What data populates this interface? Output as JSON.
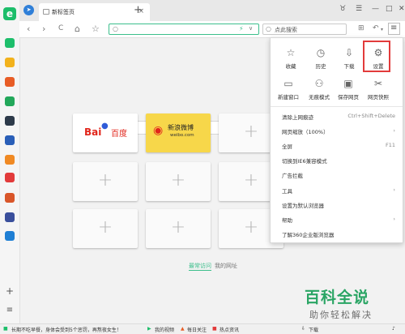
{
  "browser": {
    "tab_title": "新标签页",
    "tab_close": "×",
    "new_tab": "+"
  },
  "toolbar": {
    "back": "‹",
    "forward": "›",
    "reload": "C",
    "home": "⌂",
    "star": "☆",
    "addr_dropdown": "∨",
    "search_placeholder": "点此搜索",
    "menu": "≡"
  },
  "window_controls": [
    "♉",
    "☰",
    "—",
    "□",
    "✕"
  ],
  "tiles": [
    {
      "label_a": "Bai",
      "label_b": "百度"
    },
    {
      "label_a": "新浪微博",
      "label_b": "weibo.com"
    }
  ],
  "content": {
    "tab_frequent": "最常访问",
    "tab_mysites": "我的网址"
  },
  "menu": {
    "icons": [
      {
        "label": "收藏",
        "icon": "star-icon"
      },
      {
        "label": "历史",
        "icon": "clock-icon"
      },
      {
        "label": "下载",
        "icon": "download-icon"
      },
      {
        "label": "设置",
        "icon": "gear-icon"
      },
      {
        "label": "新建窗口",
        "icon": "window-icon"
      },
      {
        "label": "无痕模式",
        "icon": "incognito-icon"
      },
      {
        "label": "保存网页",
        "icon": "save-icon"
      },
      {
        "label": "网页快照",
        "icon": "snapshot-icon"
      }
    ],
    "items": [
      {
        "label": "清除上网痕迹",
        "key": "Ctrl+Shift+Delete"
      },
      {
        "label": "网页缩放（100%）",
        "key": "›"
      },
      {
        "label": "全屏",
        "key": "F11"
      },
      {
        "label": "切换到IE6兼容模式",
        "key": ""
      },
      {
        "label": "广告拦截",
        "key": ""
      },
      {
        "label": "工具",
        "key": "›"
      },
      {
        "label": "设置为默认浏览器",
        "key": ""
      },
      {
        "label": "帮助",
        "key": "›"
      },
      {
        "label": "了解360企业版浏览器",
        "key": ""
      }
    ]
  },
  "status_bar": {
    "news": "长期不吃早餐，身体会受到5个惩罚，再熬夜女生！",
    "video": "我的视频",
    "follow": "每日关注",
    "hot": "热点资讯",
    "download": "下载"
  },
  "watermark": {
    "title": "百科全说",
    "subtitle": "助你轻松解决"
  },
  "colors": {
    "accent_green": "#1dbe6b",
    "highlight_red": "#e23b3b"
  }
}
